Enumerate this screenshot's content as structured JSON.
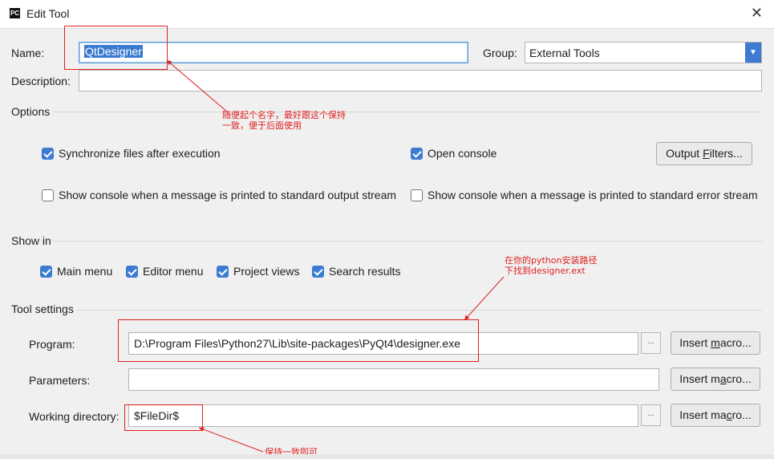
{
  "window": {
    "title": "Edit Tool",
    "icon_text": "PC"
  },
  "fields": {
    "name_label": "Name:",
    "name_value": "QtDesigner",
    "group_label": "Group:",
    "group_value": "External Tools",
    "description_label": "Description:",
    "description_value": ""
  },
  "options": {
    "section_label": "Options",
    "sync_files": {
      "label": "Synchronize files after execution",
      "checked": true
    },
    "open_console": {
      "label": "Open console",
      "checked": true
    },
    "output_filters_label": "Output Filters...",
    "console_stdout": {
      "label": "Show console when a message is printed to standard output stream",
      "checked": false
    },
    "console_stderr": {
      "label": "Show console when a message is printed to standard error stream",
      "checked": false
    }
  },
  "show_in": {
    "section_label": "Show in",
    "items": [
      {
        "label": "Main menu",
        "checked": true
      },
      {
        "label": "Editor menu",
        "checked": true
      },
      {
        "label": "Project views",
        "checked": true
      },
      {
        "label": "Search results",
        "checked": true
      }
    ]
  },
  "tool_settings": {
    "section_label": "Tool settings",
    "program_label": "Program:",
    "program_value": "D:\\Program Files\\Python27\\Lib\\site-packages\\PyQt4\\designer.exe",
    "parameters_label": "Parameters:",
    "parameters_value": "",
    "working_dir_label": "Working directory:",
    "working_dir_value": "$FileDir$",
    "browse_label": "...",
    "insert_macro_label": "Insert macro..."
  },
  "annotations": {
    "note_name_line1": "随便起个名字，最好跟这个保持",
    "note_name_line2": "一致，便于后面使用",
    "note_program_line1": "在你的python安装路径",
    "note_program_line2": "下找到designer.ext",
    "note_workdir": "保持一致即可",
    "annotation_color": "#e02020"
  },
  "colors": {
    "accent": "#3d7bd3",
    "focus_border": "#5b9bd5"
  }
}
